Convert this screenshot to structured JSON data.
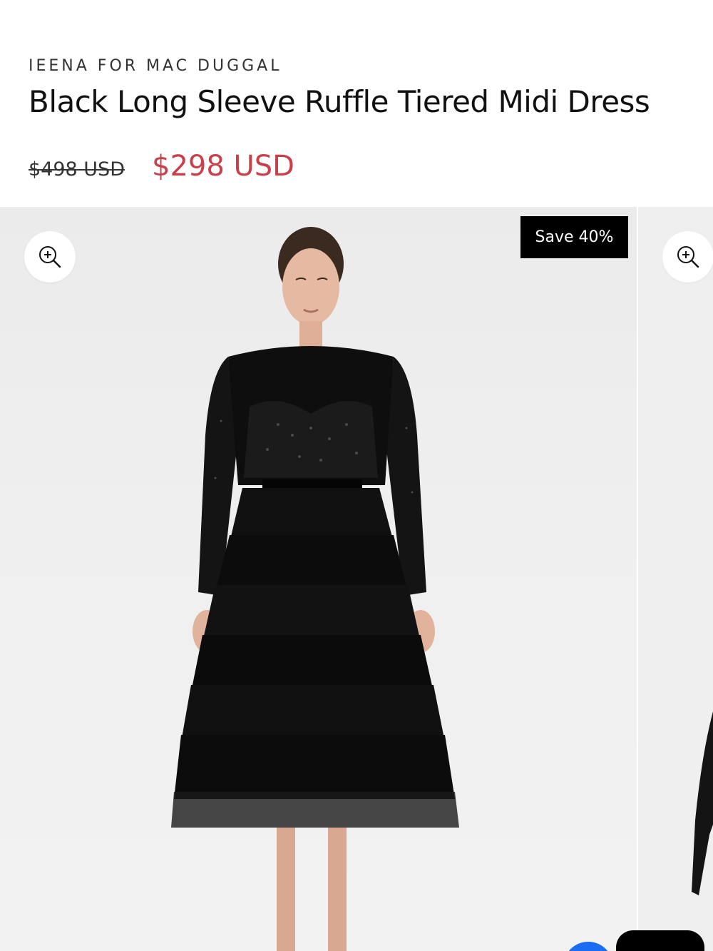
{
  "product": {
    "brand": "IEENA FOR MAC DUGGAL",
    "title": "Black Long Sleeve Ruffle Tiered Midi Dress",
    "original_price": "$498 USD",
    "sale_price": "$298 USD"
  },
  "gallery": {
    "badge": "Save 40%",
    "zoom_icon": "zoom-in-icon",
    "image_subject": "model-photo-black-ruffle-dress"
  },
  "colors": {
    "sale_price": "#c8404a",
    "badge_background": "#000000",
    "badge_text": "#ffffff",
    "gallery_background": "#efefef"
  }
}
